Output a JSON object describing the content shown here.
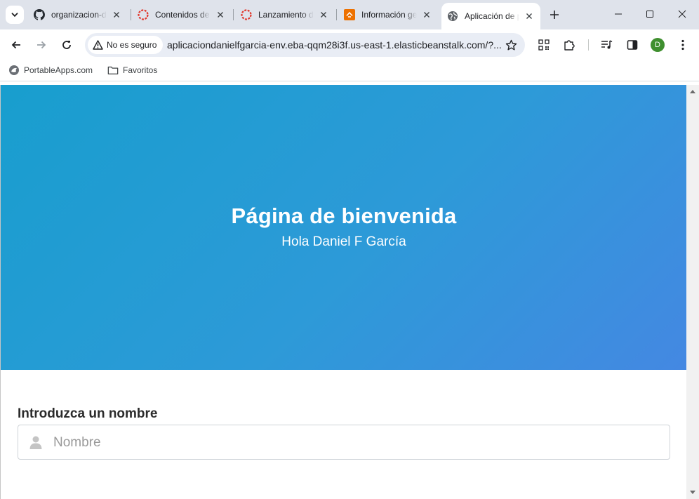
{
  "tabs": [
    {
      "title": "organizacion-daniel",
      "favicon": "github-icon",
      "active": false
    },
    {
      "title": "Contenidos de la unidad",
      "favicon": "canvas-icon",
      "active": false
    },
    {
      "title": "Lanzamiento de la aplicación",
      "favicon": "canvas-icon",
      "active": false
    },
    {
      "title": "Información general",
      "favicon": "aws-icon",
      "active": false
    },
    {
      "title": "Aplicación de prueba",
      "favicon": "globe-icon",
      "active": true
    }
  ],
  "toolbar": {
    "security_label": "No es seguro",
    "url": "aplicaciondanielfgarcia-env.eba-qqm28i3f.us-east-1.elasticbeanstalk.com/?...",
    "profile_initial": "D"
  },
  "bookmarks": [
    {
      "label": "PortableApps.com",
      "icon": "portableapps-icon"
    },
    {
      "label": "Favoritos",
      "icon": "folder-icon"
    }
  ],
  "page": {
    "hero_title": "Página de bienvenida",
    "hero_subtitle": "Hola Daniel F García",
    "form_label": "Introduzca un nombre",
    "name_placeholder": "Nombre",
    "name_value": ""
  },
  "colors": {
    "hero_gradient_start": "#189ece",
    "hero_gradient_end": "#4488e2",
    "tabstrip": "#dfe3eb",
    "avatar": "#3f8f2f"
  }
}
